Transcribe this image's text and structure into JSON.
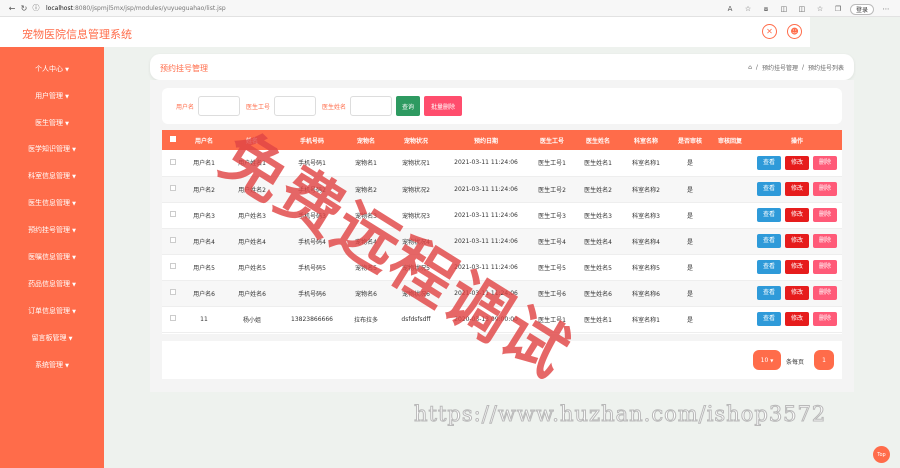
{
  "browser": {
    "url_host": "localhost",
    "url_path": ":8080/jspmjl5mx/jsp/modules/yuyueguahao/list.jsp",
    "user_label": "登录"
  },
  "header": {
    "system_title": "宠物医院信息管理系统"
  },
  "sidebar": {
    "items": [
      {
        "label": "个人中心"
      },
      {
        "label": "用户管理"
      },
      {
        "label": "医生管理"
      },
      {
        "label": "医学知识管理"
      },
      {
        "label": "科室信息管理"
      },
      {
        "label": "医生信息管理"
      },
      {
        "label": "预约挂号管理"
      },
      {
        "label": "医嘱信息管理"
      },
      {
        "label": "药品信息管理"
      },
      {
        "label": "订单信息管理"
      },
      {
        "label": "留言板管理"
      },
      {
        "label": "系统管理"
      }
    ]
  },
  "page": {
    "title": "预约挂号管理",
    "breadcrumb": [
      "预约挂号管理",
      "预约挂号列表"
    ]
  },
  "search": {
    "label_user": "用户名",
    "label_doctor_id": "医生工号",
    "label_doctor_name": "医生姓名",
    "query_button": "查询",
    "batch_delete_button": "批量删除"
  },
  "table": {
    "columns": [
      "",
      "用户名",
      "姓名",
      "手机号码",
      "宠物名",
      "宠物状况",
      "预约日期",
      "医生工号",
      "医生姓名",
      "科室名称",
      "是否审核",
      "审核回复",
      "操作"
    ],
    "rows": [
      [
        "用户名1",
        "用户姓名1",
        "手机号码1",
        "宠物名1",
        "宠物状况1",
        "2021-03-11 11:24:06",
        "医生工号1",
        "医生姓名1",
        "科室名称1",
        "是",
        ""
      ],
      [
        "用户名2",
        "用户姓名2",
        "手机号码2",
        "宠物名2",
        "宠物状况2",
        "2021-03-11 11:24:06",
        "医生工号2",
        "医生姓名2",
        "科室名称2",
        "是",
        ""
      ],
      [
        "用户名3",
        "用户姓名3",
        "手机号码3",
        "宠物名3",
        "宠物状况3",
        "2021-03-11 11:24:06",
        "医生工号3",
        "医生姓名3",
        "科室名称3",
        "是",
        ""
      ],
      [
        "用户名4",
        "用户姓名4",
        "手机号码4",
        "宠物名4",
        "宠物状况4",
        "2021-03-11 11:24:06",
        "医生工号4",
        "医生姓名4",
        "科室名称4",
        "是",
        ""
      ],
      [
        "用户名5",
        "用户姓名5",
        "手机号码5",
        "宠物名5",
        "宠物状况5",
        "2021-03-11 11:24:06",
        "医生工号5",
        "医生姓名5",
        "科室名称5",
        "是",
        ""
      ],
      [
        "用户名6",
        "用户姓名6",
        "手机号码6",
        "宠物名6",
        "宠物状况6",
        "2021-03-11 11:24:06",
        "医生工号6",
        "医生姓名6",
        "科室名称6",
        "是",
        ""
      ],
      [
        "11",
        "杨小姐",
        "13823866666",
        "拉布拉多",
        "dsfdsfsdff",
        "2020-03-13 09:00:00",
        "医生工号1",
        "医生姓名1",
        "科室名称1",
        "是",
        ""
      ]
    ],
    "actions": {
      "view": "查看",
      "edit": "修改",
      "delete": "删除"
    }
  },
  "pager": {
    "page_size": "10",
    "per_page_label": "条每页",
    "current_page": "1"
  },
  "watermark": {
    "text": "免费远程调试",
    "url": "https://www.huzhan.com/ishop3572"
  },
  "back_to_top": "Top",
  "colors": {
    "primary": "#ff6c4a",
    "view": "#2e9ad9",
    "edit": "#e61c1c",
    "delete": "#ff5a78",
    "query": "#2e9a61"
  }
}
